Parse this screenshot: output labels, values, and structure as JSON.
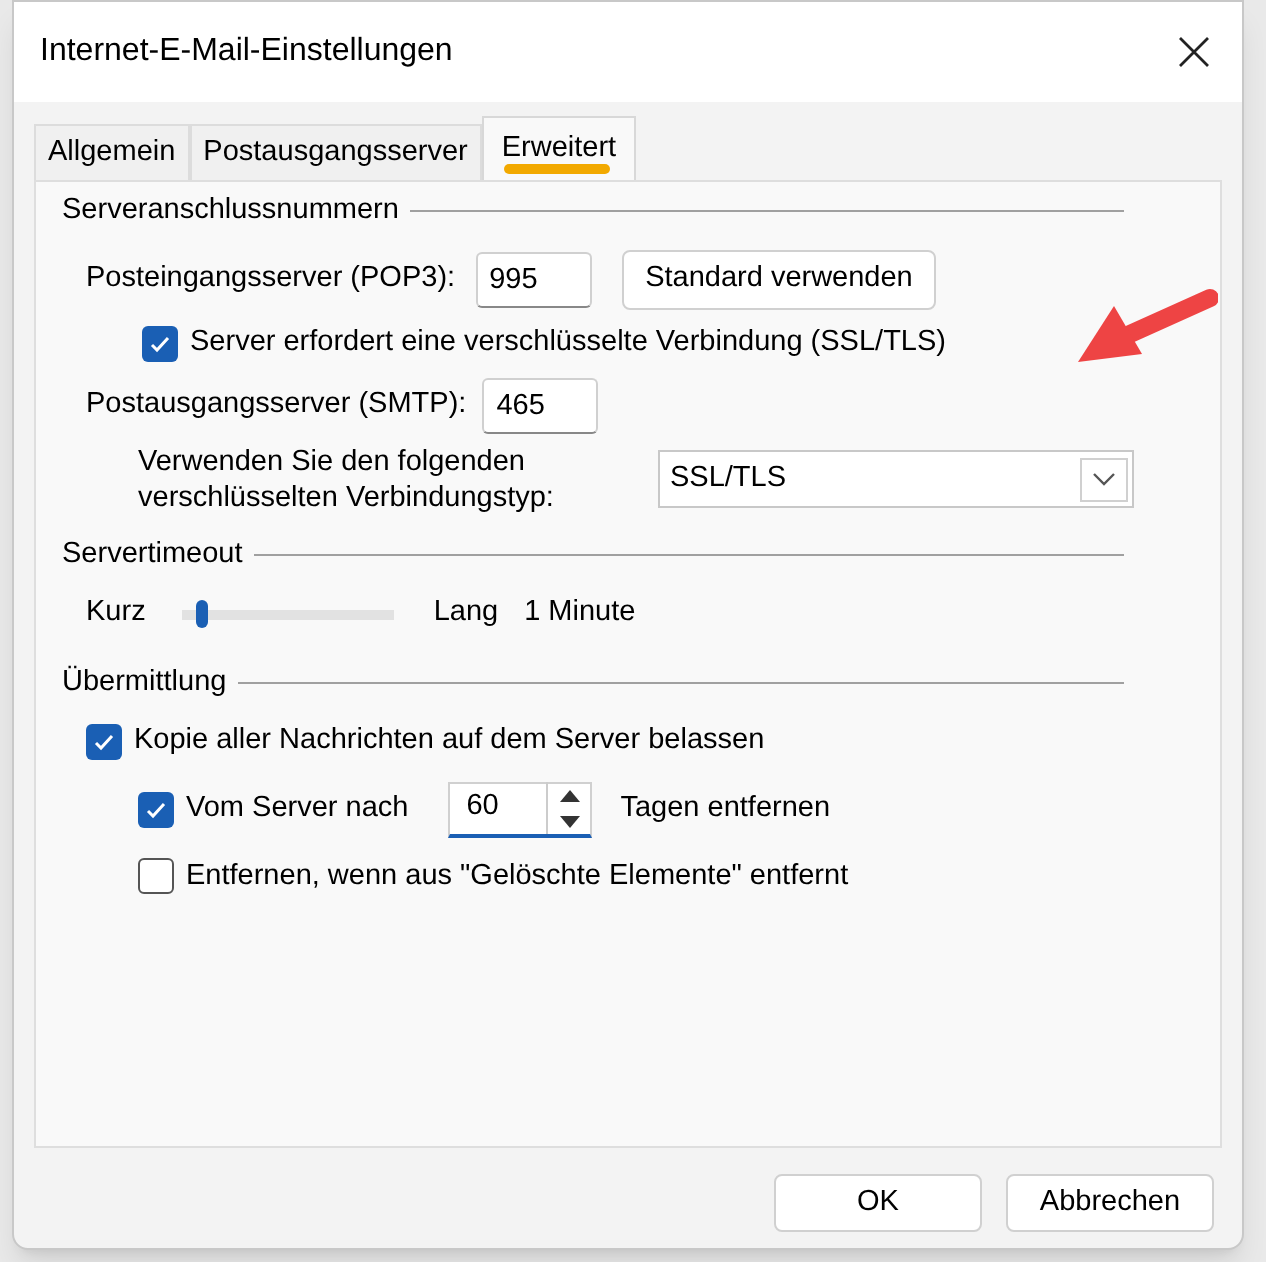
{
  "window": {
    "title": "Internet-E-Mail-Einstellungen"
  },
  "tabs": [
    {
      "label": "Allgemein",
      "selected": false
    },
    {
      "label": "Postausgangsserver",
      "selected": false
    },
    {
      "label": "Erweitert",
      "selected": true
    }
  ],
  "port_section": {
    "title": "Serveranschlussnummern",
    "incoming_label": "Posteingangsserver (POP3):",
    "incoming_value": "995",
    "default_button": "Standard verwenden",
    "ssl_checkbox": {
      "label": "Server erfordert eine verschlüsselte Verbindung (SSL/TLS)",
      "checked": true
    },
    "outgoing_label": "Postausgangsserver (SMTP):",
    "outgoing_value": "465",
    "encryption_label": "Verwenden Sie den folgenden verschlüsselten Verbindungstyp:",
    "encryption_value": "SSL/TLS"
  },
  "timeout_section": {
    "title": "Servertimeout",
    "min_label": "Kurz",
    "level": 0.1,
    "max_label": "Lang",
    "value": "1 Minute"
  },
  "delivery_section": {
    "title": "Übermittlung",
    "options": [
      {
        "label": "Kopie aller Nachrichten auf dem Server belassen",
        "checked": true
      },
      {
        "label": "Vom Server nach",
        "checked": true,
        "days": "60",
        "suffix": "Tagen entfernen"
      },
      {
        "label": "Entfernen, wenn aus \"Gelöschte Elemente\" entfernt",
        "checked": false
      }
    ]
  },
  "buttons": [
    "OK",
    "Abbrechen"
  ]
}
